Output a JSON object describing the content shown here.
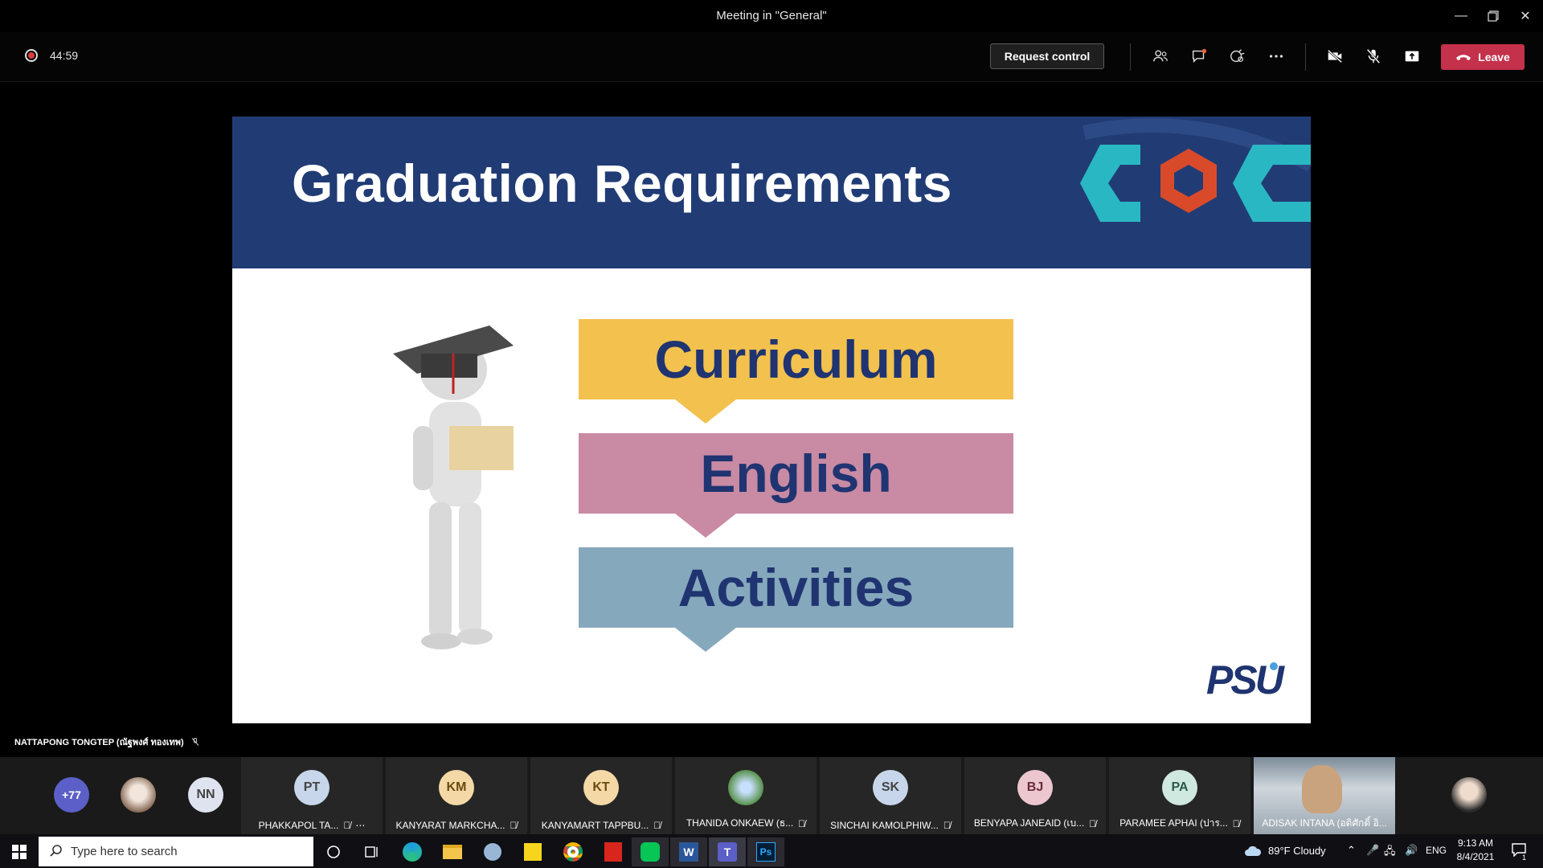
{
  "window": {
    "title": "Meeting in \"General\""
  },
  "toolbar": {
    "timer": "44:59",
    "request_control_label": "Request control",
    "leave_label": "Leave"
  },
  "slide": {
    "title": "Graduation Requirements",
    "items": [
      "Curriculum",
      "English",
      "Activities"
    ],
    "logo_text": "PSU",
    "colors": {
      "header": "#213c74",
      "curriculum": "#f2c14e",
      "english": "#c98aa4",
      "activities": "#86a8bd"
    }
  },
  "presenter": {
    "name": "NATTAPONG TONGTEP (ณัฐพงศ์ ทองเทพ)"
  },
  "participants": {
    "overflow_count": "+77",
    "small_avatars": [
      {
        "initials": "NN"
      }
    ],
    "tiles": [
      {
        "initials": "PT",
        "name": "PHAKKAPOL TA...",
        "avatar_color": "#c7d6ea"
      },
      {
        "initials": "KM",
        "name": "KANYARAT MARKCHA...",
        "avatar_color": "#f4d9a7"
      },
      {
        "initials": "KT",
        "name": "KANYAMART TAPPBU...",
        "avatar_color": "#f4d9a7"
      },
      {
        "initials": "",
        "name": "THANIDA ONKAEW (ธ...",
        "avatar_color": "#8bb06b"
      },
      {
        "initials": "SK",
        "name": "SINCHAI KAMOLPHIW...",
        "avatar_color": "#c7d6ea"
      },
      {
        "initials": "BJ",
        "name": "BENYAPA JANEAID (เบ...",
        "avatar_color": "#ecc7cf"
      },
      {
        "initials": "PA",
        "name": "PARAMEE APHAI (ปาร...",
        "avatar_color": "#cfe8e0"
      },
      {
        "initials": "",
        "name": "ADISAK INTANA (อดิศักดิ์ อิ...",
        "avatar_color": "#8a9aa8"
      }
    ]
  },
  "taskbar": {
    "search_placeholder": "Type here to search",
    "weather": "89°F  Cloudy",
    "language": "ENG",
    "time": "9:13 AM",
    "date": "8/4/2021",
    "notification_count": "1"
  }
}
